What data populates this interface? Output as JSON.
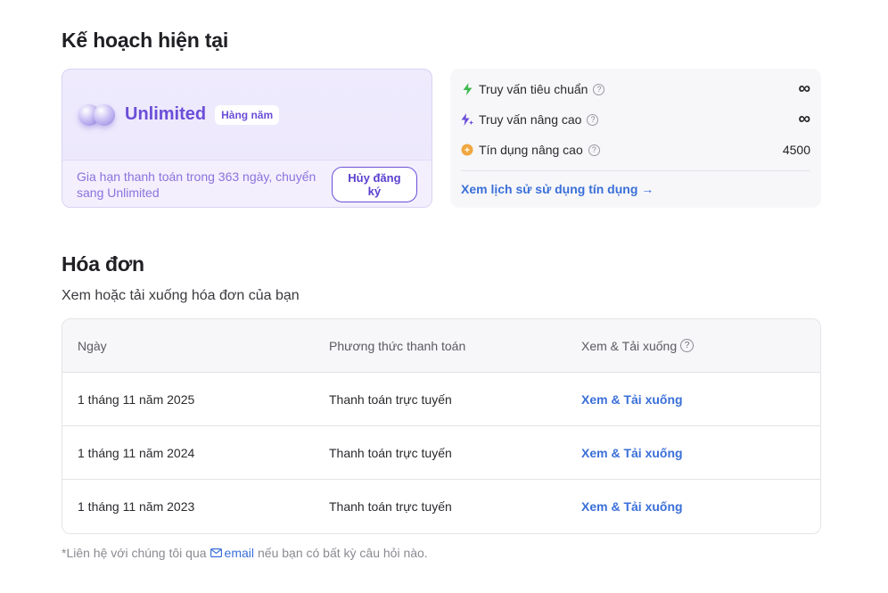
{
  "plan": {
    "title": "Kế hoạch hiện tại",
    "name": "Unlimited",
    "badge": "Hàng năm",
    "description": "Gia hạn thanh toán trong 363 ngày, chuyển sang Unlimited",
    "cancel_label": "Hủy đăng ký"
  },
  "credits": {
    "rows": [
      {
        "label": "Truy vấn tiêu chuẩn",
        "value": "∞",
        "icon": "lightning-icon",
        "color": "#3fb950"
      },
      {
        "label": "Truy vấn nâng cao",
        "value": "∞",
        "icon": "sparkle-lightning-icon",
        "color": "#6b4fd8"
      },
      {
        "label": "Tín dụng nâng cao",
        "value": "4500",
        "icon": "coin-icon",
        "color": "#f0a640"
      }
    ],
    "history_link": "Xem lịch sử sử dụng tín dụng"
  },
  "invoices": {
    "title": "Hóa đơn",
    "subtitle": "Xem hoặc tải xuống hóa đơn của bạn",
    "columns": [
      "Ngày",
      "Phương thức thanh toán",
      "Xem & Tải xuống"
    ],
    "rows": [
      {
        "date": "1 tháng 11 năm 2025",
        "method": "Thanh toán trực tuyến",
        "action": "Xem & Tải xuống"
      },
      {
        "date": "1 tháng 11 năm 2024",
        "method": "Thanh toán trực tuyến",
        "action": "Xem & Tải xuống"
      },
      {
        "date": "1 tháng 11 năm 2023",
        "method": "Thanh toán trực tuyến",
        "action": "Xem & Tải xuống"
      }
    ]
  },
  "footer": {
    "prefix": "*Liên hệ với chúng tôi qua",
    "email_label": "email",
    "suffix": "nếu bạn có bất kỳ câu hỏi nào."
  },
  "colors": {
    "accent_purple": "#6b4fd8",
    "link_blue": "#3a6fd8"
  }
}
